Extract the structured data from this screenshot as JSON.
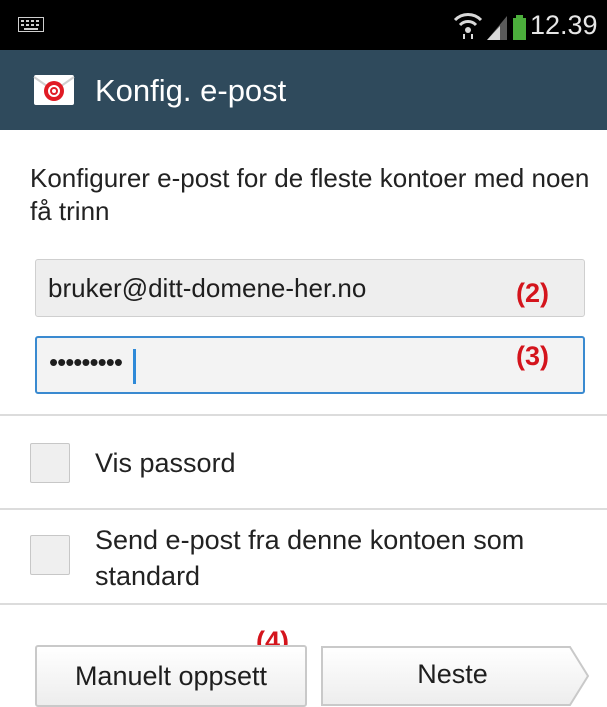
{
  "status_bar": {
    "time": "12.39",
    "icons": [
      "keyboard-icon",
      "wifi-icon",
      "signal-icon",
      "battery-icon"
    ],
    "battery_color": "#4caf3c"
  },
  "action_bar": {
    "title": "Konfig. e-post",
    "icon": "email-app-icon",
    "background_color": "#2f4a5c"
  },
  "intro_text": "Konfigurer e-post for de fleste kontoer med noen få trinn",
  "email_field": {
    "value": "bruker@ditt-domene-her.no",
    "annotation": "(2)"
  },
  "password_field": {
    "masked_value": "•••••••••",
    "annotation": "(3)",
    "focused": true,
    "focus_color": "#3a8ad0"
  },
  "checkboxes": [
    {
      "label": "Vis passord",
      "checked": false
    },
    {
      "label": "Send e-post fra denne kontoen som standard",
      "checked": false
    }
  ],
  "buttons": {
    "manual_setup": "Manuelt oppsett",
    "next": "Neste",
    "annotation": "(4)"
  },
  "annotation_color": "#d4141c"
}
